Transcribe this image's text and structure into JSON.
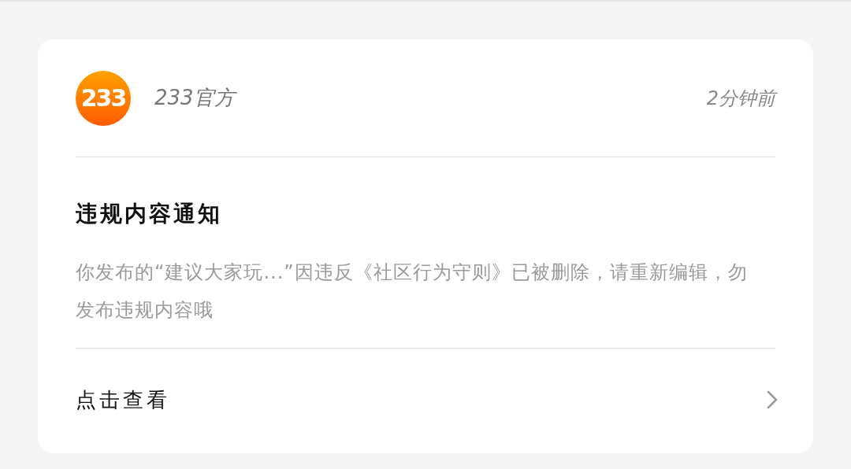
{
  "sender": {
    "logo_text": "233",
    "name": "233官方",
    "time": "2分钟前"
  },
  "notice": {
    "title": "违规内容通知",
    "body": "你发布的“建议大家玩...”因违反《社区行为守则》已被删除，请重新编辑，勿发布违规内容哦"
  },
  "footer": {
    "link": "点击查看"
  }
}
